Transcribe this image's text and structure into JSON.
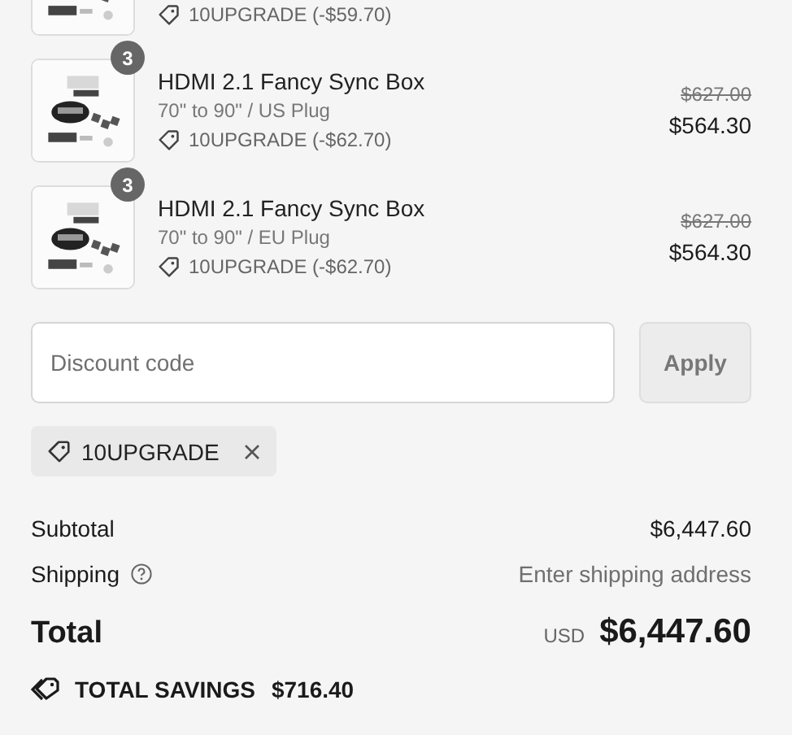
{
  "items": [
    {
      "discount": "10UPGRADE (-$59.70)"
    },
    {
      "quantity": "3",
      "title": "HDMI 2.1 Fancy Sync Box",
      "variant": "70\" to 90\" / US Plug",
      "discount": "10UPGRADE (-$62.70)",
      "original_price": "$627.00",
      "price": "$564.30"
    },
    {
      "quantity": "3",
      "title": "HDMI 2.1 Fancy Sync Box",
      "variant": "70\" to 90\" / EU Plug",
      "discount": "10UPGRADE (-$62.70)",
      "original_price": "$627.00",
      "price": "$564.30"
    }
  ],
  "discount_field": {
    "placeholder": "Discount code"
  },
  "apply_button": "Apply",
  "applied_code": "10UPGRADE",
  "summary": [
    {
      "kind": "plain",
      "label": "Subtotal",
      "value": "$6,447.60"
    },
    {
      "kind": "help",
      "label": "Shipping",
      "value": "Enter shipping address"
    }
  ],
  "total": {
    "label": "Total",
    "currency": "USD",
    "value": "$6,447.60"
  },
  "savings": {
    "label": "TOTAL SAVINGS",
    "value": "$716.40"
  }
}
